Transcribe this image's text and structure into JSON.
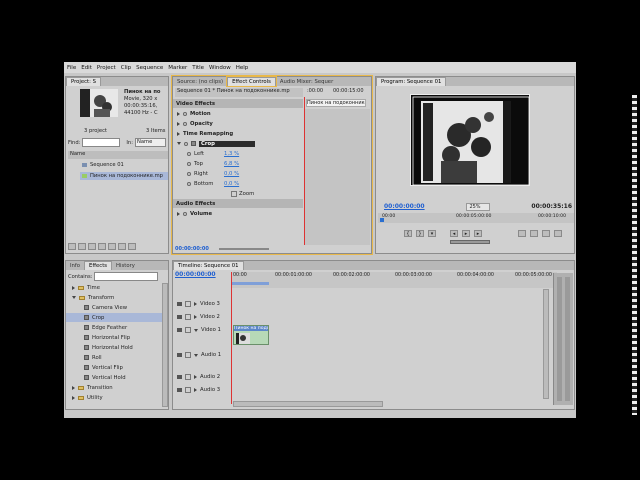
{
  "menu": [
    "File",
    "Edit",
    "Project",
    "Clip",
    "Sequence",
    "Marker",
    "Title",
    "Window",
    "Help"
  ],
  "project": {
    "tab": "Project: S",
    "clip_name": "Пинок на по",
    "clip_info": [
      "Movie, 320 x",
      "00:00:35:16,",
      "44100 Hz - C"
    ],
    "items_count": "3 project",
    "items_label": "3 Items",
    "find_label": "Find:",
    "in_label": "In:",
    "in_value": "Name",
    "name_header": "Name",
    "items": [
      "Sequence 01",
      "Пинок на подоконнике.mp"
    ]
  },
  "effect_controls": {
    "tabs": [
      "Source: (no clips)",
      "Effect Controls",
      "Audio Mixer: Sequer"
    ],
    "header": "Sequence 01 * Пинок на подоконнике.mp",
    "ruler_start": ":00:00",
    "ruler_mid": "00:00:15:00",
    "clip_label": "Пинок на подоконнике.",
    "video_effects": "Video Effects",
    "motion": "Motion",
    "opacity": "Opacity",
    "time_remapping": "Time Remapping",
    "crop": "Crop",
    "params": [
      {
        "name": "Left",
        "value": "1,3 %"
      },
      {
        "name": "Top",
        "value": "6,8 %"
      },
      {
        "name": "Right",
        "value": "0,0 %"
      },
      {
        "name": "Bottom",
        "value": "0,0 %"
      }
    ],
    "zoom": "Zoom",
    "audio_effects": "Audio Effects",
    "volume": "Volume",
    "timecode": "00:00:00:00"
  },
  "program": {
    "tab": "Program: Sequence 01",
    "timecode": "00:00:00:00",
    "zoom": "25%",
    "duration": "00:00:35:16",
    "ruler": [
      "00:00",
      "00:00:05:00:00",
      "00:00:10:00"
    ]
  },
  "effects": {
    "tabs": [
      "Info",
      "Effects",
      "History"
    ],
    "contains_label": "Contains:",
    "tree": [
      {
        "label": "Time",
        "type": "folder"
      },
      {
        "label": "Transform",
        "type": "folder-open"
      },
      {
        "label": "Camera View",
        "type": "fx"
      },
      {
        "label": "Crop",
        "type": "fx",
        "selected": true
      },
      {
        "label": "Edge Feather",
        "type": "fx"
      },
      {
        "label": "Horizontal Flip",
        "type": "fx"
      },
      {
        "label": "Horizontal Hold",
        "type": "fx"
      },
      {
        "label": "Roll",
        "type": "fx"
      },
      {
        "label": "Vertical Flip",
        "type": "fx"
      },
      {
        "label": "Vertical Hold",
        "type": "fx"
      },
      {
        "label": "Transition",
        "type": "folder"
      },
      {
        "label": "Utility",
        "type": "folder"
      }
    ]
  },
  "timeline": {
    "tab": "Timeline: Sequence 01",
    "timecode": "00:00:00:00",
    "ruler": [
      "00:00",
      "00:00:01:00:00",
      "00:00:02:00:00",
      "00:00:03:00:00",
      "00:00:04:00:00",
      "00:00:05:00:00"
    ],
    "tracks": [
      "Video 3",
      "Video 2",
      "Video 1",
      "Audio 1",
      "Audio 2",
      "Audio 3"
    ],
    "clip_label": "Пинок на подо"
  },
  "colors": {
    "panel_bg": "#d0d0d0",
    "accent_blue": "#2a6fd0",
    "selection": "#a9b8d8",
    "highlight_yellow": "#e8b84a"
  }
}
